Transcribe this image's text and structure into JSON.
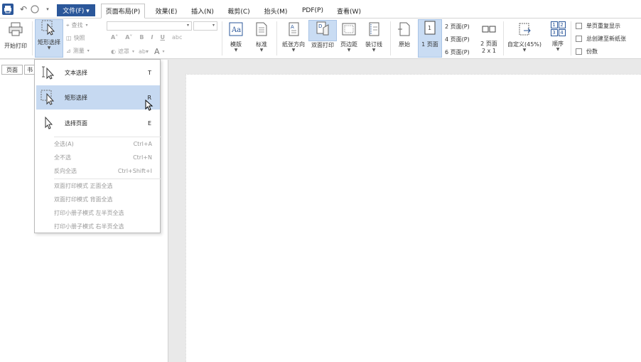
{
  "menubar": {
    "file_label": "文件(F) ▾",
    "tabs": [
      {
        "label": "页面布局(P)"
      },
      {
        "label": "效果(E)"
      },
      {
        "label": "插入(N)"
      },
      {
        "label": "裁剪(C)"
      },
      {
        "label": "抬头(M)"
      },
      {
        "label": "PDF(P)"
      },
      {
        "label": "查看(W)"
      }
    ]
  },
  "ribbon": {
    "start_print": "开始打印",
    "rect_select": "矩形选择",
    "find": "查找",
    "snapshot": "快照",
    "measure": "测量",
    "mask": "遮罩",
    "template": "模版",
    "standard": "标准",
    "paper_direction": "纸张方向",
    "duplex": "双面打印",
    "margins": "页边距",
    "binding": "装订线",
    "original": "原始",
    "one_page": "1 页面",
    "two_pages": "2 页面(P)",
    "four_pages": "4 页面(P)",
    "six_pages": "6 页面(P)",
    "two_page_label": "2 页面",
    "two_by_one": "2 x 1",
    "custom_zoom": "自定义(45%)",
    "order": "顺序",
    "order_nums": [
      "1",
      "2",
      "3",
      "4"
    ],
    "single_repeat": "单页重复显示",
    "always_new_sheet": "总创建至新纸张",
    "copies": "份数"
  },
  "leftpanel": {
    "tab_pages": "页面",
    "tab_bookmarks": "书"
  },
  "dropdown": {
    "big": [
      {
        "label": "文本选择",
        "key": "T"
      },
      {
        "label": "矩形选择",
        "key": "R"
      },
      {
        "label": "选择页面",
        "key": "E"
      }
    ],
    "group1": [
      {
        "label": "全选(A)",
        "key": "Ctrl+A"
      },
      {
        "label": "全不选",
        "key": "Ctrl+N"
      },
      {
        "label": "反向全选",
        "key": "Ctrl+Shift+I"
      }
    ],
    "group2": [
      {
        "label": "双面打印模式 正面全选"
      },
      {
        "label": "双面打印模式 背面全选"
      },
      {
        "label": "打印小册子模式 左半页全选"
      },
      {
        "label": "打印小册子模式 右半页全选"
      }
    ]
  },
  "colors": {
    "accent": "#2b579a",
    "selection": "#c6d9f1"
  }
}
